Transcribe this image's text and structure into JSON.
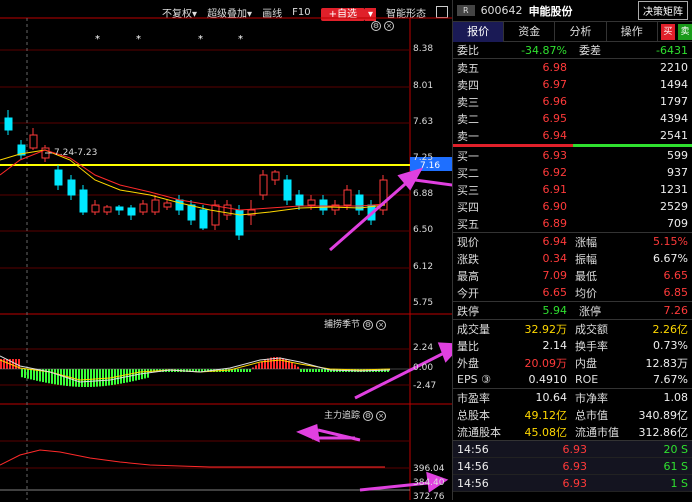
{
  "toolbar": {
    "items": [
      "不复权▾",
      "超级叠加▾",
      "画线",
      "F10"
    ],
    "add_watch": "+自选",
    "dropdown": "▾",
    "smart": "智能形态"
  },
  "price_axis": [
    "8.38",
    "8.01",
    "7.63",
    "7.25",
    "6.88",
    "6.50",
    "6.12",
    "5.75"
  ],
  "current_price_tag": "7.16",
  "range_annotation": "7.24-7.23",
  "panel2": {
    "title": "捕捞季节",
    "axis": [
      "2.24",
      "0.00",
      "-2.47"
    ]
  },
  "panel3": {
    "title": "主力追踪",
    "axis": [
      "396.04",
      "384.40",
      "372.76"
    ]
  },
  "header": {
    "badge": "R",
    "code": "600642",
    "name": "申能股份",
    "button": "决策矩阵"
  },
  "tabs": [
    "报价",
    "资金",
    "分析",
    "操作"
  ],
  "buy_btn": "买",
  "sell_btn": "卖",
  "weibi": {
    "label1": "委比",
    "value1": "-34.87%",
    "label2": "委差",
    "value2": "-6431"
  },
  "sell_orders": [
    {
      "label": "卖五",
      "price": "6.98",
      "vol": "2210"
    },
    {
      "label": "卖四",
      "price": "6.97",
      "vol": "1494"
    },
    {
      "label": "卖三",
      "price": "6.96",
      "vol": "1797"
    },
    {
      "label": "卖二",
      "price": "6.95",
      "vol": "4394"
    },
    {
      "label": "卖一",
      "price": "6.94",
      "vol": "2541"
    }
  ],
  "buy_orders": [
    {
      "label": "买一",
      "price": "6.93",
      "vol": "599"
    },
    {
      "label": "买二",
      "price": "6.92",
      "vol": "937"
    },
    {
      "label": "买三",
      "price": "6.91",
      "vol": "1231"
    },
    {
      "label": "买四",
      "price": "6.90",
      "vol": "2529"
    },
    {
      "label": "买五",
      "price": "6.89",
      "vol": "709"
    }
  ],
  "stats1": [
    {
      "l1": "现价",
      "v1": "6.94",
      "l2": "涨幅",
      "v2": "5.15%"
    },
    {
      "l1": "涨跌",
      "v1": "0.34",
      "l2": "振幅",
      "v2": "6.67%"
    },
    {
      "l1": "最高",
      "v1": "7.09",
      "l2": "最低",
      "v2": "6.65"
    },
    {
      "l1": "今开",
      "v1": "6.65",
      "l2": "均价",
      "v2": "6.85"
    }
  ],
  "limit": {
    "l1": "跌停",
    "v1": "5.94",
    "l2": "涨停",
    "v2": "7.26"
  },
  "stats2": [
    {
      "l1": "成交量",
      "v1": "32.92万",
      "l2": "成交额",
      "v2": "2.26亿"
    },
    {
      "l1": "量比",
      "v1": "2.14",
      "l2": "换手率",
      "v2": "0.73%"
    },
    {
      "l1": "外盘",
      "v1": "20.09万",
      "l2": "内盘",
      "v2": "12.83万"
    },
    {
      "l1": "EPS ③",
      "v1": "0.4910",
      "l2": "ROE",
      "v2": "7.67%"
    }
  ],
  "stats3": [
    {
      "l1": "市盈率",
      "v1": "10.64",
      "l2": "市净率",
      "v2": "1.08"
    },
    {
      "l1": "总股本",
      "v1": "49.12亿",
      "l2": "总市值",
      "v2": "340.89亿"
    },
    {
      "l1": "流通股本",
      "v1": "45.08亿",
      "l2": "流通市值",
      "v2": "312.86亿"
    }
  ],
  "ticks": [
    {
      "time": "14:56",
      "price": "6.93",
      "vol": "20 S"
    },
    {
      "time": "14:56",
      "price": "6.93",
      "vol": "61 S"
    },
    {
      "time": "14:56",
      "price": "6.93",
      "vol": "1 S"
    }
  ],
  "colors": {
    "up": "#ff3a3a",
    "down": "#00e8ff",
    "ma_yellow": "#ffd800",
    "ma_red": "#ff2a2a",
    "arrow": "#e040e0"
  }
}
